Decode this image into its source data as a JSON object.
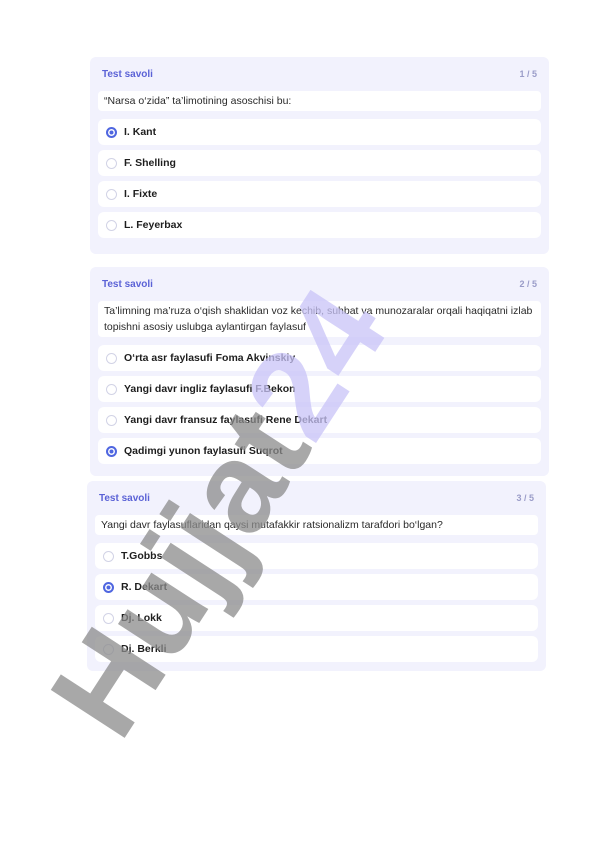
{
  "cards": [
    {
      "title": "Test savoli",
      "count": "1 / 5",
      "question": "“Narsa o‘zida” ta’limotining asoschisi bu:",
      "options": [
        {
          "label": "I. Kant",
          "selected": true
        },
        {
          "label": "F. Shelling",
          "selected": false
        },
        {
          "label": "I. Fixte",
          "selected": false
        },
        {
          "label": "L. Feyerbax",
          "selected": false
        }
      ]
    },
    {
      "title": "Test savoli",
      "count": "2 / 5",
      "question": "Ta’limning ma’ruza o‘qish shaklidan voz kechib, suhbat va munozaralar orqali haqiqatni izlab topishni asosiy uslubga aylantirgan faylasuf",
      "options": [
        {
          "label": "O‘rta asr faylasufi Foma Akvinskiy",
          "selected": false
        },
        {
          "label": "Yangi davr ingliz faylasufi F.Bekon",
          "selected": false
        },
        {
          "label": "Yangi davr fransuz faylasufi Rene Dekart",
          "selected": false
        },
        {
          "label": "Qadimgi yunon faylasufi Suqrot",
          "selected": true
        }
      ]
    },
    {
      "title": "Test savoli",
      "count": "3 / 5",
      "question": "Yangi davr faylasuflaridan qaysi mutafakkir ratsionalizm tarafdori bo‘lgan?",
      "options": [
        {
          "label": "T.Gobbs",
          "selected": false
        },
        {
          "label": "R. Dekart",
          "selected": true
        },
        {
          "label": "Dj. Lokk",
          "selected": false
        },
        {
          "label": "Dj. Berkli",
          "selected": false
        }
      ]
    }
  ],
  "watermark": {
    "part1": "Hujjat",
    "part2": "24",
    "color1": "#8c8c8c",
    "color2": "#c9c4f8"
  },
  "colors": {
    "accent": "#5b62d6",
    "card_bg": "#f2f2fd",
    "radio_checked": "#4f66e0"
  }
}
